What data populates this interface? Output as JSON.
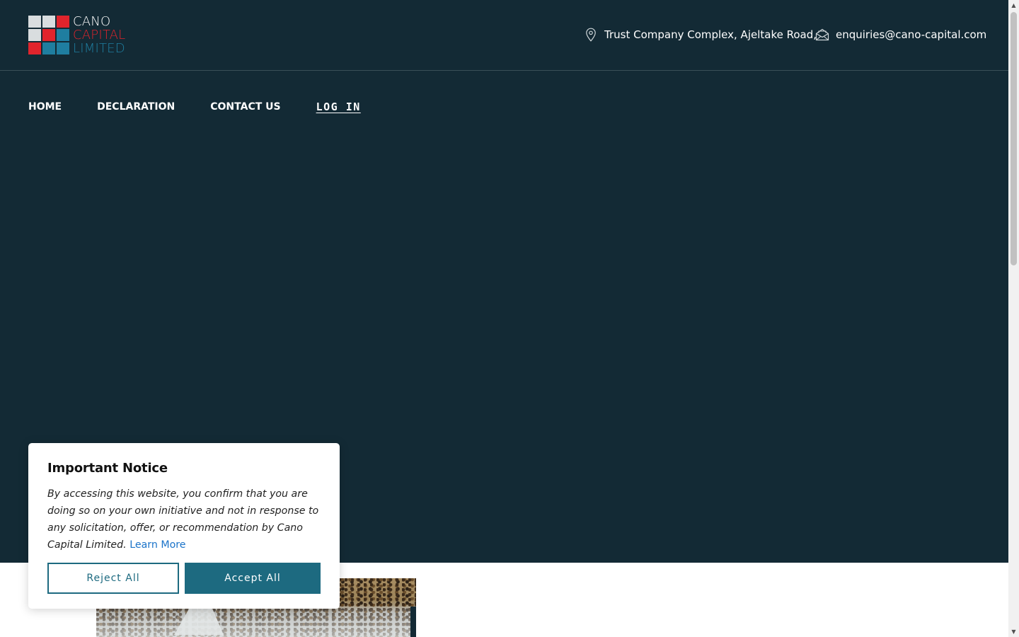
{
  "brand": {
    "logo_line1": "CANO",
    "logo_line2": "CAPITAL",
    "logo_line3": "LIMITED",
    "colors": {
      "line1": "#ffffff",
      "line2": "#e0242c",
      "line3": "#1f7ea0",
      "tile_light": "#d9dddf",
      "tile_red": "#e0242c",
      "tile_teal": "#1f7ea0"
    }
  },
  "header": {
    "address": "Trust Company Complex, Ajeltake Road,",
    "address_icon": "map-pin-icon",
    "email": "enquiries@cano-capital.com",
    "email_icon": "envelope-open-icon"
  },
  "nav": {
    "items": [
      "HOME",
      "DECLARATION",
      "CONTACT US",
      "LOG IN"
    ]
  },
  "notice": {
    "title": "Important Notice",
    "body": "By accessing this website, you confirm that you are doing so on your own initiative and not in response to any solicitation, offer, or recommendation by Cano Capital Limited.",
    "learn_more": "Learn More",
    "reject_label": "Reject All",
    "accept_label": "Accept All"
  },
  "theme": {
    "hero_bg": "#132a35",
    "accent": "#1d6a80",
    "link": "#1a73c9"
  }
}
